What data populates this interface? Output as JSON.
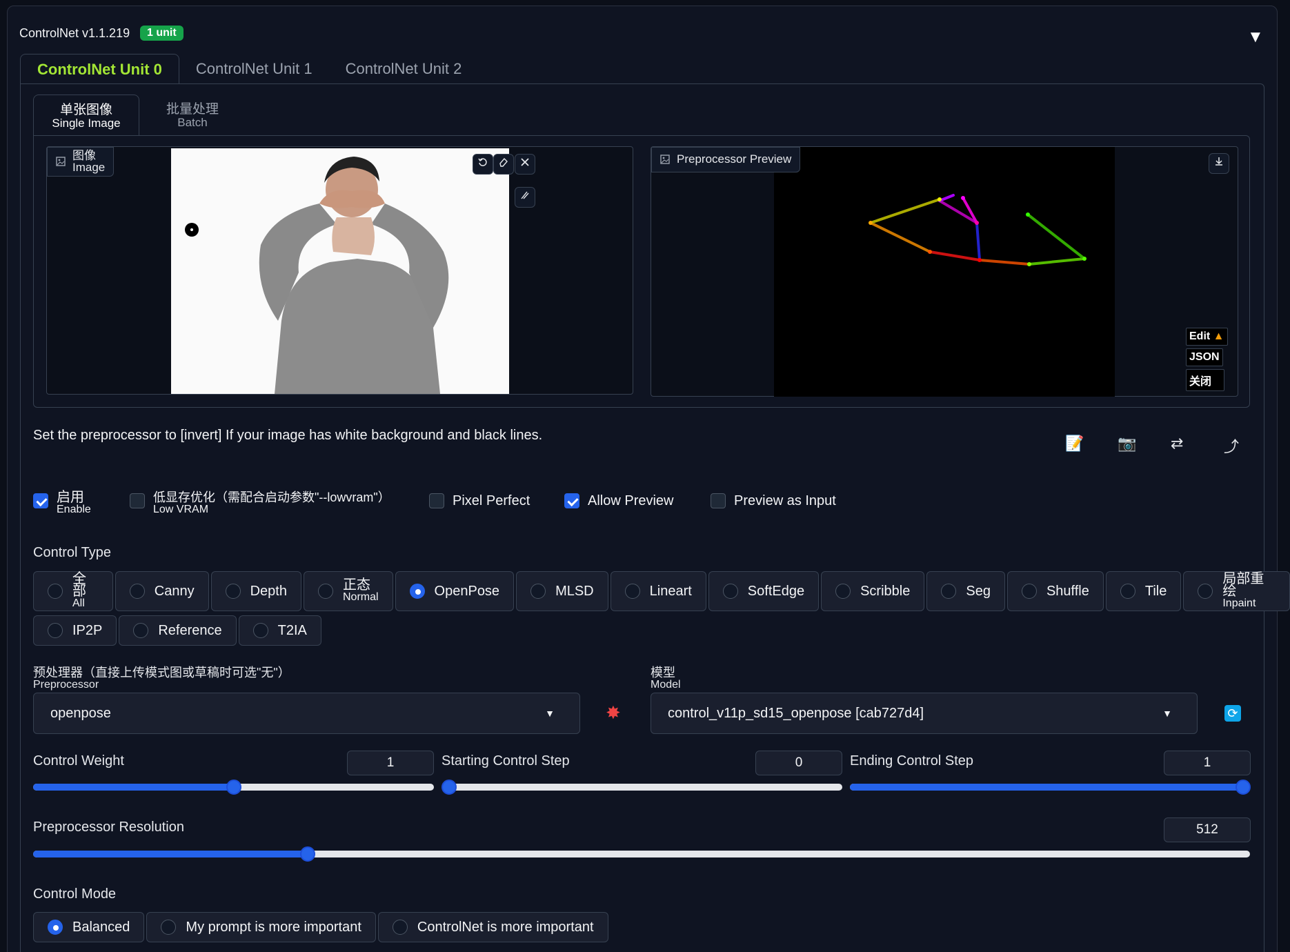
{
  "header": {
    "title": "ControlNet v1.1.219",
    "badge": "1 unit",
    "caret": "▼"
  },
  "unit_tabs": [
    "ControlNet Unit 0",
    "ControlNet Unit 1",
    "ControlNet Unit 2"
  ],
  "mode_tabs": [
    {
      "zh": "单张图像",
      "en": "Single Image"
    },
    {
      "zh": "批量处理",
      "en": "Batch"
    }
  ],
  "image_box": {
    "zh": "图像",
    "en": "Image"
  },
  "preview_box": {
    "label": "Preprocessor Preview",
    "edit": "Edit",
    "json": "JSON",
    "close": "关闭"
  },
  "hint": "Set the preprocessor to [invert] If your image has white background and black lines.",
  "toggles": {
    "enable": {
      "zh": "启用",
      "en": "Enable",
      "checked": true
    },
    "lowvram": {
      "zh": "低显存优化（需配合启动参数\"--lowvram\"）",
      "en": "Low VRAM",
      "checked": false
    },
    "pixel_perfect": {
      "label": "Pixel Perfect",
      "checked": false
    },
    "allow_preview": {
      "label": "Allow Preview",
      "checked": true
    },
    "preview_as_input": {
      "label": "Preview as Input",
      "checked": false
    }
  },
  "control_type": {
    "label": "Control Type",
    "selected": "OpenPose",
    "row1": [
      {
        "zh": "全部",
        "en": "All"
      },
      {
        "label": "Canny"
      },
      {
        "label": "Depth"
      },
      {
        "zh": "正态",
        "en": "Normal"
      },
      {
        "label": "OpenPose"
      },
      {
        "label": "MLSD"
      },
      {
        "label": "Lineart"
      },
      {
        "label": "SoftEdge"
      },
      {
        "label": "Scribble"
      },
      {
        "label": "Seg"
      },
      {
        "label": "Shuffle"
      },
      {
        "label": "Tile"
      },
      {
        "zh": "局部重绘",
        "en": "Inpaint"
      }
    ],
    "row2": [
      {
        "label": "IP2P"
      },
      {
        "label": "Reference"
      },
      {
        "label": "T2IA"
      }
    ]
  },
  "preprocessor": {
    "zh": "预处理器（直接上传模式图或草稿时可选\"无\"）",
    "en": "Preprocessor",
    "value": "openpose"
  },
  "model": {
    "zh": "模型",
    "en": "Model",
    "value": "control_v11p_sd15_openpose [cab727d4]"
  },
  "sliders": {
    "control_weight": {
      "label": "Control Weight",
      "value": "1",
      "min": 0,
      "max": 2,
      "pos": 0.5
    },
    "starting_step": {
      "label": "Starting Control Step",
      "value": "0",
      "min": 0,
      "max": 1,
      "pos": 0
    },
    "ending_step": {
      "label": "Ending Control Step",
      "value": "1",
      "min": 0,
      "max": 1,
      "pos": 1
    },
    "preprocessor_resolution": {
      "label": "Preprocessor Resolution",
      "value": "512",
      "min": 64,
      "max": 2048,
      "pos": 0.2258
    }
  },
  "control_mode": {
    "label": "Control Mode",
    "selected": "Balanced",
    "options": [
      "Balanced",
      "My prompt is more important",
      "ControlNet is more important"
    ]
  }
}
